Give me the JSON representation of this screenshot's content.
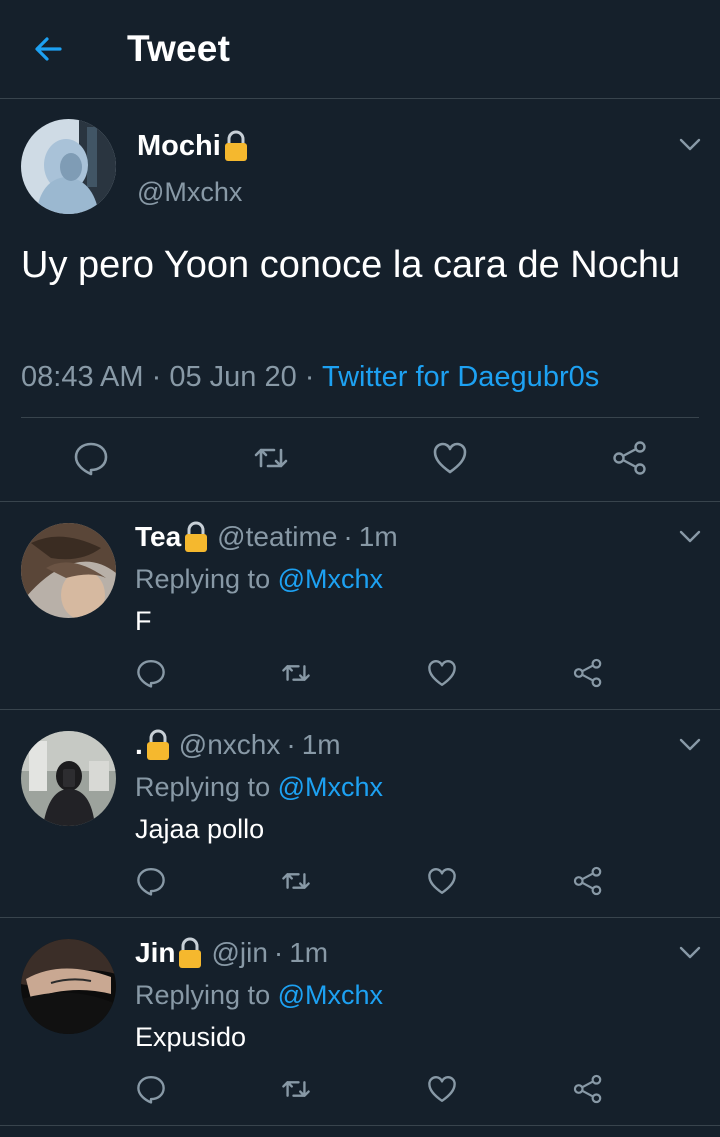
{
  "header": {
    "title": "Tweet"
  },
  "main_tweet": {
    "name": "Mochi",
    "handle": "@Mxchx",
    "text": "Uy pero Yoon conoce la cara de Nochu",
    "time": "08:43 AM",
    "date": "05 Jun 20",
    "separator": "·",
    "source": "Twitter for Daegubr0s"
  },
  "replies": [
    {
      "name": "Tea",
      "handle": "@teatime",
      "time": "1m",
      "replying_label": "Replying to",
      "mention": "@Mxchx",
      "text": "F"
    },
    {
      "name": ".",
      "handle": "@nxchx",
      "time": "1m",
      "replying_label": "Replying to",
      "mention": "@Mxchx",
      "text": "Jajaa pollo"
    },
    {
      "name": "Jin",
      "handle": "@jin",
      "time": "1m",
      "replying_label": "Replying to",
      "mention": "@Mxchx",
      "text": "Expusido"
    }
  ],
  "separator": "·",
  "icons": {
    "back": "arrow-left-icon",
    "lock": "lock-icon",
    "reply": "comment-icon",
    "retweet": "retweet-icon",
    "like": "heart-icon",
    "share": "share-icon",
    "menu": "chevron-down-icon"
  },
  "colors": {
    "background": "#15202b",
    "accent": "#1da1f2",
    "secondary_text": "#8899a6",
    "divider": "#38444d",
    "lock": "#f5b82e"
  }
}
